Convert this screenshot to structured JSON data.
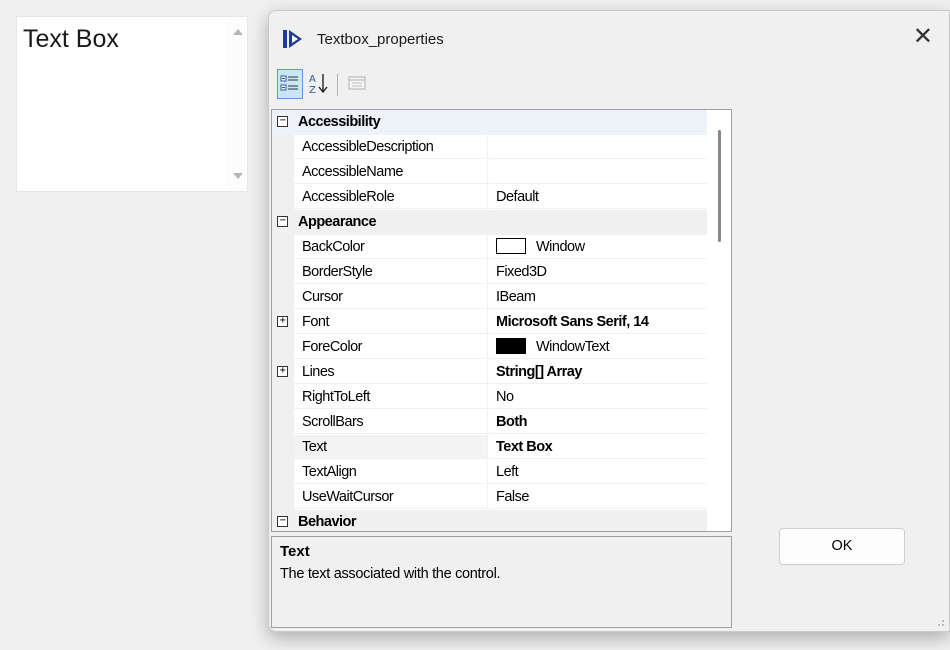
{
  "textbox": {
    "text": "Text Box"
  },
  "dialog": {
    "title": "Textbox_properties",
    "close_icon": "close-icon",
    "app_icon": "app-icon"
  },
  "toolbar": {
    "buttons": [
      {
        "icon": "categorized-icon",
        "active": true
      },
      {
        "icon": "alphabetical-sort-icon",
        "active": false
      },
      {
        "icon": "property-pages-icon",
        "active": false
      }
    ]
  },
  "grid": {
    "rows": [
      {
        "type": "category",
        "label": "Accessibility",
        "expander": "⊟"
      },
      {
        "type": "prop",
        "name": "AccessibleDescription",
        "value": ""
      },
      {
        "type": "prop",
        "name": "AccessibleName",
        "value": ""
      },
      {
        "type": "prop",
        "name": "AccessibleRole",
        "value": "Default"
      },
      {
        "type": "category",
        "label": "Appearance",
        "expander": "⊟"
      },
      {
        "type": "prop",
        "name": "BackColor",
        "value": "Window",
        "swatch": "#ffffff"
      },
      {
        "type": "prop",
        "name": "BorderStyle",
        "value": "Fixed3D"
      },
      {
        "type": "prop",
        "name": "Cursor",
        "value": "IBeam"
      },
      {
        "type": "prop",
        "name": "Font",
        "value": "Microsoft Sans Serif, 14",
        "bold": true,
        "expandable": true
      },
      {
        "type": "prop",
        "name": "ForeColor",
        "value": "WindowText",
        "swatch": "#000000"
      },
      {
        "type": "prop",
        "name": "Lines",
        "value": "String[] Array",
        "bold": true,
        "expandable": true
      },
      {
        "type": "prop",
        "name": "RightToLeft",
        "value": "No"
      },
      {
        "type": "prop",
        "name": "ScrollBars",
        "value": "Both",
        "bold": true
      },
      {
        "type": "prop",
        "name": "Text",
        "value": "Text Box",
        "bold": true,
        "selected": true
      },
      {
        "type": "prop",
        "name": "TextAlign",
        "value": "Left"
      },
      {
        "type": "prop",
        "name": "UseWaitCursor",
        "value": "False"
      },
      {
        "type": "category",
        "label": "Behavior",
        "expander": "⊟"
      }
    ]
  },
  "help": {
    "title": "Text",
    "description": "The text associated with the control."
  },
  "buttons": {
    "ok_label": "OK"
  }
}
